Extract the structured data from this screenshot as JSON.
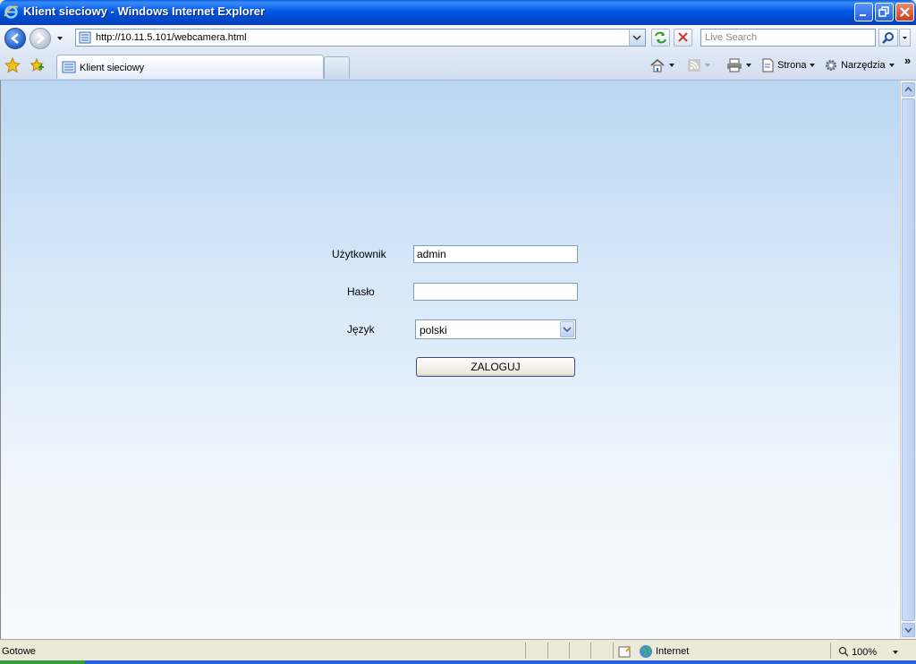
{
  "window": {
    "title": "Klient sieciowy - Windows Internet Explorer"
  },
  "addressbar": {
    "url": "http://10.11.5.101/webcamera.html"
  },
  "search": {
    "placeholder": "Live Search"
  },
  "tabs": [
    {
      "label": "Klient sieciowy"
    }
  ],
  "commandbar": {
    "page_label": "Strona",
    "tools_label": "Narzędzia"
  },
  "login": {
    "user_label": "Użytkownik",
    "user_value": "admin",
    "password_label": "Hasło",
    "password_value": "",
    "language_label": "Język",
    "language_value": "polski",
    "submit_label": "ZALOGUJ"
  },
  "statusbar": {
    "status": "Gotowe",
    "zone": "Internet",
    "zoom": "100%"
  },
  "colors": {
    "accent": "#0058e6",
    "page_top": "#bcd7f3",
    "page_bottom": "#f7fafe"
  }
}
